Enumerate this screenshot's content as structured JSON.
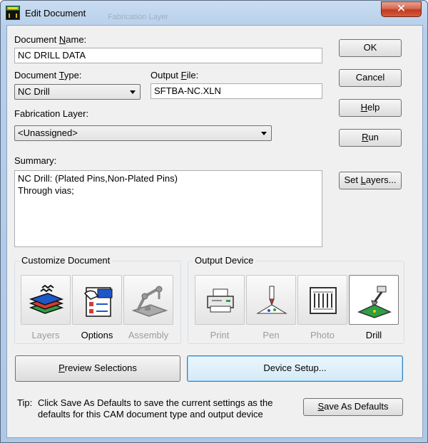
{
  "window": {
    "title": "Edit Document",
    "ghost_text": "Fabrication Layer",
    "close_glyph": "✕"
  },
  "document_name": {
    "label_pre": "Document ",
    "label_key": "N",
    "label_post": "ame:",
    "value": "NC DRILL DATA"
  },
  "document_type": {
    "label_pre": "Document ",
    "label_key": "T",
    "label_post": "ype:",
    "value": "NC Drill"
  },
  "output_file": {
    "label_pre": "Output ",
    "label_key": "F",
    "label_post": "ile:",
    "value": "SFTBA-NC.XLN"
  },
  "fabrication_layer": {
    "label": "Fabrication Layer:",
    "value": "<Unassigned>"
  },
  "summary": {
    "label": "Summary:",
    "line1": "NC Drill: (Plated Pins,Non-Plated Pins)",
    "line2": "Through vias;"
  },
  "buttons": {
    "ok": "OK",
    "cancel": "Cancel",
    "help_key": "H",
    "help_rest": "elp",
    "run_key": "R",
    "run_rest": "un",
    "set_layers_pre": "Set ",
    "set_layers_key": "L",
    "set_layers_post": "ayers...",
    "preview_key": "P",
    "preview_rest": "review Selections",
    "device_setup": "Device Setup...",
    "save_defaults_key": "S",
    "save_defaults_rest": "ave As Defaults"
  },
  "customize_document": {
    "title": "Customize Document",
    "items": [
      {
        "label": "Layers",
        "icon": "layers-icon",
        "enabled": false
      },
      {
        "label": "Options",
        "icon": "options-icon",
        "enabled": true
      },
      {
        "label": "Assembly",
        "icon": "assembly-icon",
        "enabled": false
      }
    ]
  },
  "output_device": {
    "title": "Output Device",
    "items": [
      {
        "label": "Print",
        "icon": "printer-icon",
        "enabled": false
      },
      {
        "label": "Pen",
        "icon": "pen-plotter-icon",
        "enabled": false
      },
      {
        "label": "Photo",
        "icon": "photoplotter-icon",
        "enabled": false
      },
      {
        "label": "Drill",
        "icon": "drill-icon",
        "enabled": true,
        "selected": true
      }
    ]
  },
  "tip": {
    "prefix": "Tip:",
    "line1": "Click Save As Defaults to save the current settings as the",
    "line2": "defaults for this CAM document type and output device"
  },
  "colors": {
    "accent": "#3c7fb1",
    "disabled": "#9c9c9c",
    "close": "#c13a22"
  }
}
